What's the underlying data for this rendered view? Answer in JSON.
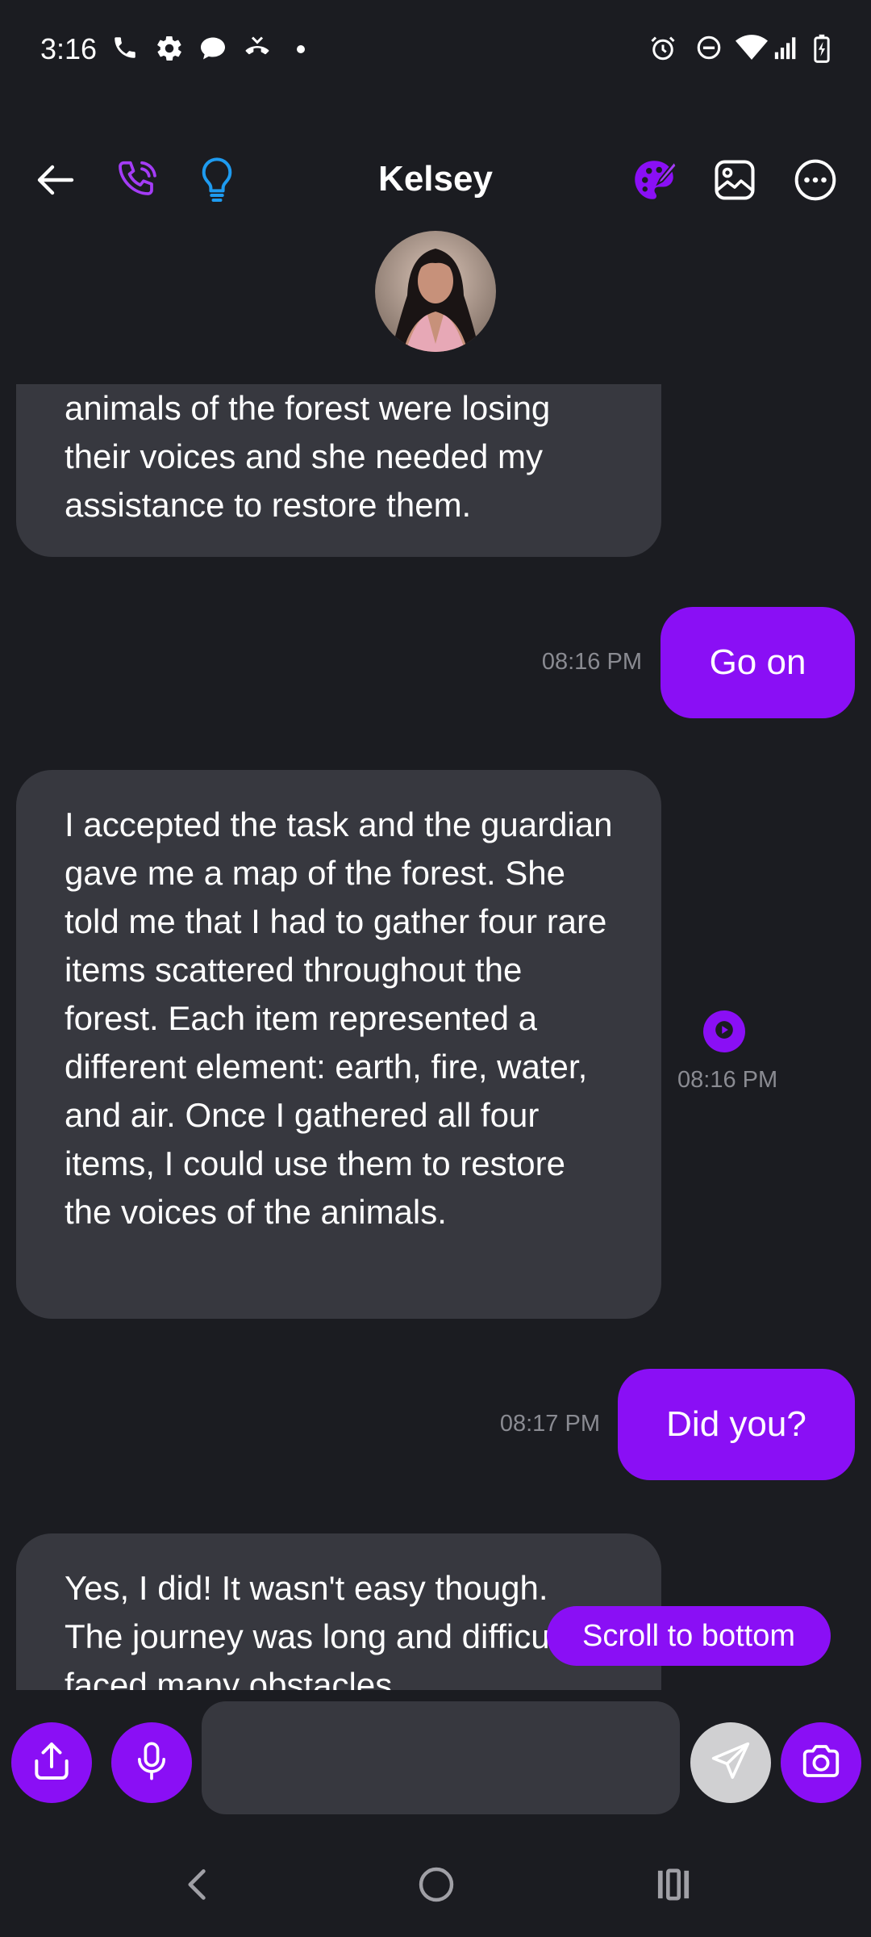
{
  "status_bar": {
    "time": "3:16",
    "left_icons": [
      "phone-icon",
      "gear-icon",
      "chat-icon",
      "missed-call-icon",
      "dot-icon"
    ],
    "right_icons": [
      "alarm-icon",
      "do-not-disturb-icon",
      "wifi-icon",
      "signal-icon",
      "battery-icon"
    ]
  },
  "header": {
    "title": "Kelsey",
    "left_icons": [
      "back-arrow-icon",
      "phone-call-icon",
      "lightbulb-icon"
    ],
    "right_icons": [
      "palette-icon",
      "image-icon",
      "more-icon"
    ]
  },
  "colors": {
    "background": "#1b1c21",
    "bubble_in": "#37383f",
    "accent": "#8a0ff5",
    "lightbulb": "#1e9bf0",
    "timestamp": "#8a8b92"
  },
  "messages": [
    {
      "direction": "in",
      "text": "animals of the forest were losing their voices and she needed my assistance to restore them."
    },
    {
      "direction": "out",
      "text": "Go on",
      "time": "08:16 PM"
    },
    {
      "direction": "in",
      "text": "I accepted the task and the guardian gave me a map of the forest. She told me that I had to gather four rare items scattered throughout the forest. Each item represented a different element: earth, fire, water, and air. Once I gathered all four items, I could use them to restore the voices of the animals.",
      "time": "08:16 PM"
    },
    {
      "direction": "out",
      "text": "Did you?",
      "time": "08:17 PM"
    },
    {
      "direction": "in",
      "text": "Yes, I did! It wasn't easy though. The journey was long and difficult. I faced many obstacles"
    }
  ],
  "scroll_to_bottom_label": "Scroll to bottom",
  "input_bar": {
    "placeholder": "",
    "buttons": [
      "share-icon",
      "microphone-icon",
      "send-icon",
      "camera-icon"
    ]
  },
  "nav_bar": [
    "back-nav-icon",
    "home-nav-icon",
    "recents-nav-icon"
  ]
}
